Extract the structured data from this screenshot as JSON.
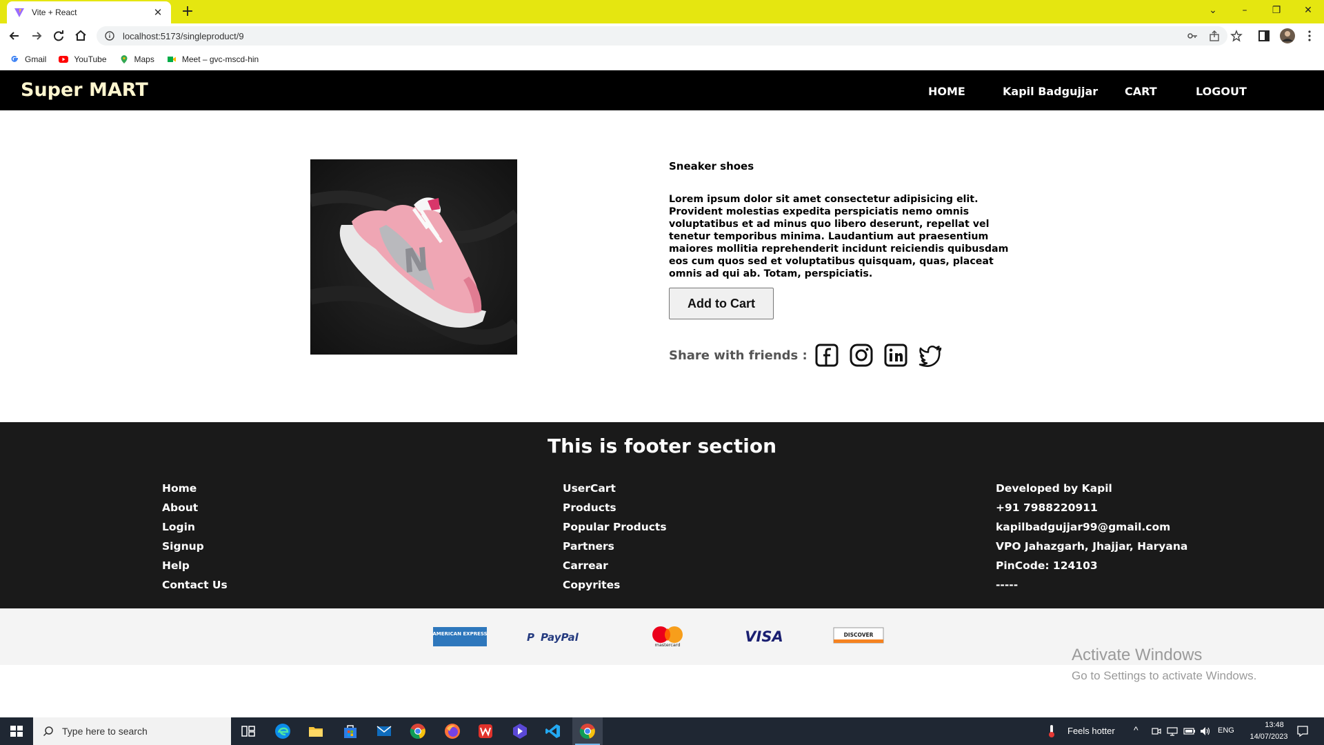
{
  "browser": {
    "tab_title": "Vite + React",
    "new_tab": "+",
    "url": "localhost:5173/singleproduct/9",
    "bookmarks": [
      {
        "label": "Gmail",
        "icon": "gmail-icon"
      },
      {
        "label": "YouTube",
        "icon": "youtube-icon"
      },
      {
        "label": "Maps",
        "icon": "maps-icon"
      },
      {
        "label": "Meet – gvc-mscd-hin",
        "icon": "meet-icon"
      }
    ]
  },
  "header": {
    "brand": "Super MART",
    "nav": [
      "HOME",
      "Kapil Badgujjar",
      "CART",
      "LOGOUT"
    ]
  },
  "product": {
    "name": "Sneaker shoes",
    "description": "Lorem ipsum dolor sit amet consectetur adipisicing elit. Provident molestias expedita perspiciatis nemo omnis voluptatibus et ad minus quo libero deserunt, repellat vel tenetur temporibus minima. Laudantium aut praesentium maiores mollitia reprehenderit incidunt reiciendis quibusdam eos cum quos sed et voluptatibus quisquam, quas, placeat omnis ad qui ab. Totam, perspiciatis.",
    "add_to_cart": "Add to Cart",
    "share_label": "Share with friends :",
    "social_icons": [
      "facebook-icon",
      "instagram-icon",
      "linkedin-icon",
      "twitter-icon"
    ]
  },
  "footer": {
    "title": "This is footer section",
    "col1": [
      "Home",
      "About",
      "Login",
      "Signup",
      "Help",
      "Contact Us"
    ],
    "col2": [
      "UserCart",
      "Products",
      "Popular Products",
      "Partners",
      "Carrear",
      "Copyrites"
    ],
    "col3": [
      "Developed by Kapil",
      "+91 7988220911",
      "kapilbadgujjar99@gmail.com",
      "VPO Jahazgarh, Jhajjar, Haryana",
      "PinCode: 124103",
      "-----"
    ]
  },
  "payments": {
    "amex": "AMERICAN EXPRESS",
    "paypal": "PayPal",
    "mastercard": "mastercard",
    "visa": "VISA",
    "discover": "DISCOVER"
  },
  "watermark": {
    "line1": "Activate Windows",
    "line2": "Go to Settings to activate Windows."
  },
  "taskbar": {
    "search_placeholder": "Type here to search",
    "weather": "Feels hotter",
    "lang": "ENG",
    "time": "13:48",
    "date": "14/07/2023"
  },
  "colors": {
    "tabbar": "#e5e610",
    "header_bg": "#000000",
    "brand": "#fff6cf",
    "footer_bg": "#1a1a1a"
  }
}
